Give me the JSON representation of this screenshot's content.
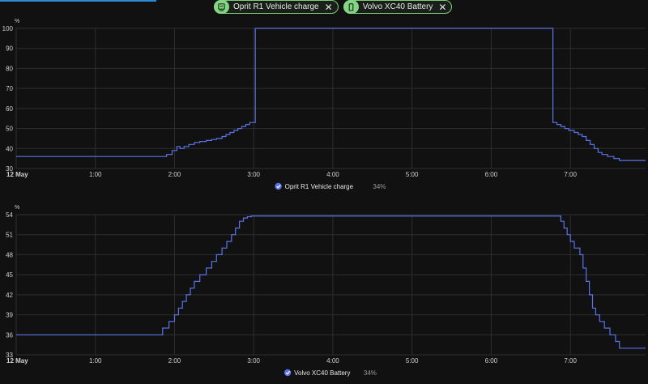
{
  "chips": [
    {
      "label": "Oprit R1 Vehicle charge",
      "icon": "ev-charger-icon"
    },
    {
      "label": "Volvo XC40 Battery",
      "icon": "battery-icon"
    }
  ],
  "colors": {
    "series": "#5b73e8",
    "grid": "#2e2e2e",
    "chip_border": "#7bd17b",
    "checkbox": "#5b73e8"
  },
  "chart_data": [
    {
      "type": "line",
      "step": true,
      "unit_label": "%",
      "ylim": [
        30,
        100
      ],
      "y_ticks": [
        30,
        40,
        50,
        60,
        70,
        80,
        90,
        100
      ],
      "x_tick_labels": [
        "12 May",
        "1:00",
        "2:00",
        "3:00",
        "4:00",
        "5:00",
        "6:00",
        "7:00"
      ],
      "xlim_hours": [
        0,
        7.95
      ],
      "legend": {
        "label": "Oprit R1 Vehicle charge",
        "value": "34%"
      },
      "series": [
        {
          "name": "Oprit R1 Vehicle charge",
          "x_hours": [
            0.0,
            1.9,
            1.97,
            2.03,
            2.07,
            2.12,
            2.18,
            2.25,
            2.32,
            2.4,
            2.47,
            2.53,
            2.6,
            2.65,
            2.7,
            2.75,
            2.8,
            2.85,
            2.9,
            2.95,
            3.02,
            6.78,
            6.83,
            6.88,
            6.93,
            6.98,
            7.05,
            7.1,
            7.15,
            7.2,
            7.25,
            7.3,
            7.35,
            7.4,
            7.47,
            7.55,
            7.62,
            7.95
          ],
          "values": [
            36,
            37,
            39,
            41,
            40,
            41,
            42,
            43,
            43.5,
            44,
            44.5,
            45,
            46,
            47,
            48,
            49,
            50,
            51,
            52,
            53,
            100,
            53,
            52,
            51,
            50,
            49,
            48,
            47,
            46,
            44,
            42,
            40,
            38,
            37,
            36,
            35,
            34,
            34
          ]
        }
      ]
    },
    {
      "type": "line",
      "step": true,
      "unit_label": "%",
      "ylim": [
        33,
        54
      ],
      "y_ticks": [
        33,
        36,
        39,
        42,
        45,
        48,
        51,
        54
      ],
      "x_tick_labels": [
        "12 May",
        "1:00",
        "2:00",
        "3:00",
        "4:00",
        "5:00",
        "6:00",
        "7:00"
      ],
      "xlim_hours": [
        0,
        7.95
      ],
      "legend": {
        "label": "Volvo XC40 Battery",
        "value": "34%"
      },
      "series": [
        {
          "name": "Volvo XC40 Battery",
          "x_hours": [
            0.0,
            1.85,
            1.93,
            2.0,
            2.05,
            2.1,
            2.15,
            2.2,
            2.25,
            2.32,
            2.4,
            2.47,
            2.53,
            2.6,
            2.66,
            2.72,
            2.77,
            2.82,
            2.87,
            2.92,
            2.97,
            6.88,
            6.92,
            6.96,
            7.0,
            7.05,
            7.12,
            7.16,
            7.2,
            7.24,
            7.28,
            7.32,
            7.37,
            7.43,
            7.5,
            7.57,
            7.62,
            7.95
          ],
          "values": [
            36,
            37,
            38,
            39,
            40,
            41,
            42,
            43,
            44,
            45,
            46,
            47,
            48,
            49,
            50,
            51,
            52,
            53,
            53.5,
            53.7,
            53.8,
            53,
            52,
            51,
            50,
            49,
            48,
            46,
            44,
            42,
            40,
            39,
            38,
            37,
            36,
            35,
            34,
            34
          ]
        }
      ]
    }
  ]
}
